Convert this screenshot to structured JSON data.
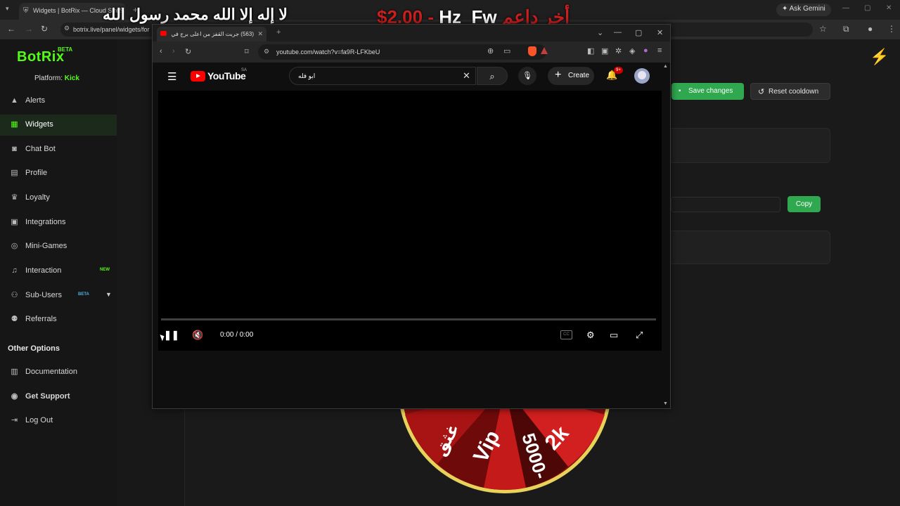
{
  "overlay": {
    "arabic_line": "لا إله إلا الله محمد رسول الله",
    "donation_amount": "$2.00",
    "donation_separator": "-",
    "donation_name": "Hz_Fw",
    "donation_label": "أخر داعم"
  },
  "chrome": {
    "tab_title": "Widgets | BotRix — Cloud Stre...",
    "url": "botrix.live/panel/widgets/for",
    "ask_gemini": "Ask Gemini"
  },
  "botrix": {
    "logo": "BotRix",
    "logo_badge": "BETA",
    "platform_label": "Platform:",
    "platform_value": "Kick",
    "nav": [
      {
        "label": "Alerts",
        "icon": "warning-icon"
      },
      {
        "label": "Widgets",
        "icon": "widgets-icon"
      },
      {
        "label": "Chat Bot",
        "icon": "chatbot-icon"
      },
      {
        "label": "Profile",
        "icon": "profile-icon"
      },
      {
        "label": "Loyalty",
        "icon": "trophy-icon"
      },
      {
        "label": "Integrations",
        "icon": "integrations-icon"
      },
      {
        "label": "Mini-Games",
        "icon": "gamepad-icon"
      },
      {
        "label": "Interaction",
        "icon": "music-icon",
        "badge": "NEW"
      },
      {
        "label": "Sub-Users",
        "icon": "users-icon",
        "badge": "BETA"
      },
      {
        "label": "Referrals",
        "icon": "referrals-icon"
      }
    ],
    "other_options_title": "Other Options",
    "other_nav": [
      {
        "label": "Documentation",
        "icon": "document-icon"
      },
      {
        "label": "Get Support",
        "icon": "support-icon"
      },
      {
        "label": "Log Out",
        "icon": "logout-icon"
      }
    ],
    "save_label": "Save changes",
    "reset_label": "Reset cooldown",
    "copy_label": "Copy",
    "accent": "#53fc18",
    "button_green": "#2fa84f",
    "wheel_segments": [
      "Vip",
      "5000-",
      "2k",
      "غثق"
    ]
  },
  "popup": {
    "tab_title": "(563) جربت القفز من اعلى برج في",
    "url": "youtube.com/watch?v=fa9R-LFKbeU",
    "youtube": {
      "logo_text": "YouTube",
      "region": "SA",
      "search_value": "ابو فله",
      "create_label": "Create",
      "notification_badge": "9+",
      "time": "0:00 / 0:00",
      "cc_label": "CC"
    }
  }
}
